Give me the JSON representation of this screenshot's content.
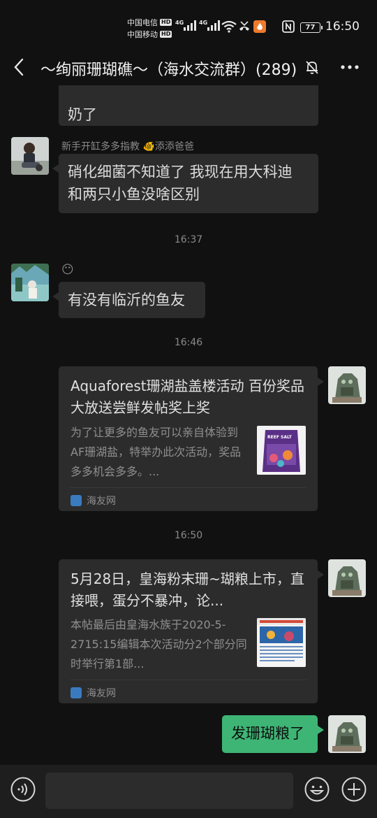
{
  "status_bar": {
    "carrier1": "中国电信",
    "carrier2": "中国移动",
    "hd": "HD",
    "sig1_label": "4G",
    "sig2_label": "4G",
    "battery": "77",
    "time": "16:50"
  },
  "header": {
    "title": "～绚丽珊瑚礁～（海水交流群）(289)",
    "back_icon": "chevron-left-icon",
    "mute_icon": "bell-off-icon",
    "more_icon": "more-dots-icon"
  },
  "messages": [
    {
      "type": "text-partial",
      "text": "奶了"
    },
    {
      "type": "text",
      "sender": "新手开缸多多指教 🐠添添爸爸",
      "text_line1": "硝化细菌不知道了 我现在用大科迪",
      "text_line2": "和两只小鱼没啥区别"
    },
    {
      "type": "time",
      "text": "16:37"
    },
    {
      "type": "text",
      "sender": "😶",
      "text": "有没有临沂的鱼友"
    },
    {
      "type": "time",
      "text": "16:46"
    },
    {
      "type": "card",
      "title": "Aquaforest珊湖盐盖楼活动 百份奖品大放送尝鲜发帖奖上奖",
      "desc": "为了让更多的鱼友可以亲自体验到AF珊湖盐，特举办此次活动，奖品多多机会多多。...",
      "thumb_text": "REEF SALT",
      "source": "海友网"
    },
    {
      "type": "time",
      "text": "16:50"
    },
    {
      "type": "card",
      "title": "5月28日，皇海粉末珊~瑚粮上市，直接喂，蛋分不暴冲，论...",
      "desc": "本帖最后由皇海水族于2020-5-2715:15编辑本次活动分2个部分同时举行第1部...",
      "source": "海友网"
    },
    {
      "type": "text-self",
      "text": "发珊瑚粮了"
    }
  ],
  "input_bar": {
    "voice_icon": "voice-icon",
    "emoji_icon": "emoji-icon",
    "plus_icon": "plus-icon",
    "placeholder": ""
  },
  "colors": {
    "background": "#111111",
    "bubble": "#2c2c2c",
    "self_bubble": "#3eb575",
    "secondary_text": "#8a8a8a"
  }
}
